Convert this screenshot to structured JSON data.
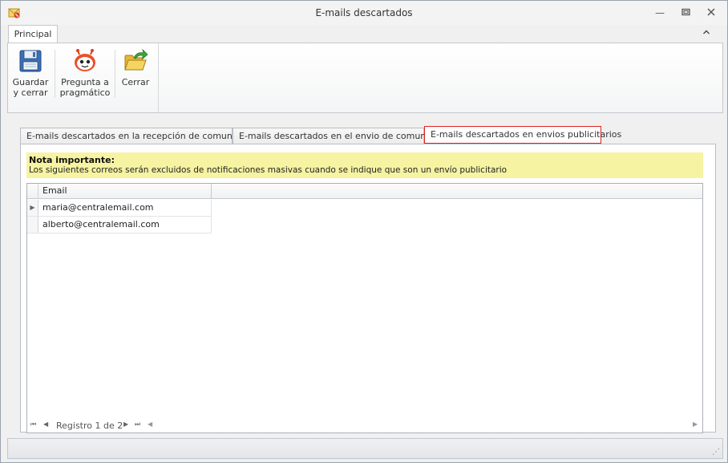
{
  "window": {
    "title": "E-mails descartados"
  },
  "ribbon": {
    "tab_label": "Principal",
    "buttons": {
      "save": "Guardar\ny cerrar",
      "save_line1": "Guardar",
      "save_line2": "y cerrar",
      "ask_line1": "Pregunta a",
      "ask_line2": "pragmático",
      "close": "Cerrar"
    }
  },
  "tabs": [
    {
      "label": "E-mails descartados en la recepción de comunicados",
      "active": false
    },
    {
      "label": "E-mails descartados en el envio de comunicado",
      "active": false
    },
    {
      "label": "E-mails descartados en envios publicitarios",
      "active": true
    }
  ],
  "note": {
    "title": "Nota importante:",
    "text": "Los siguientes correos serán excluidos de notificaciones masivas cuando se indique que son un envío publicitario"
  },
  "grid": {
    "column": "Email",
    "rows": [
      "maria@centralemail.com",
      "alberto@centralemail.com"
    ],
    "navigator": "Registro 1 de 2"
  },
  "colors": {
    "active_tab_border": "#dd2222",
    "note_background": "#f6f3a2"
  }
}
